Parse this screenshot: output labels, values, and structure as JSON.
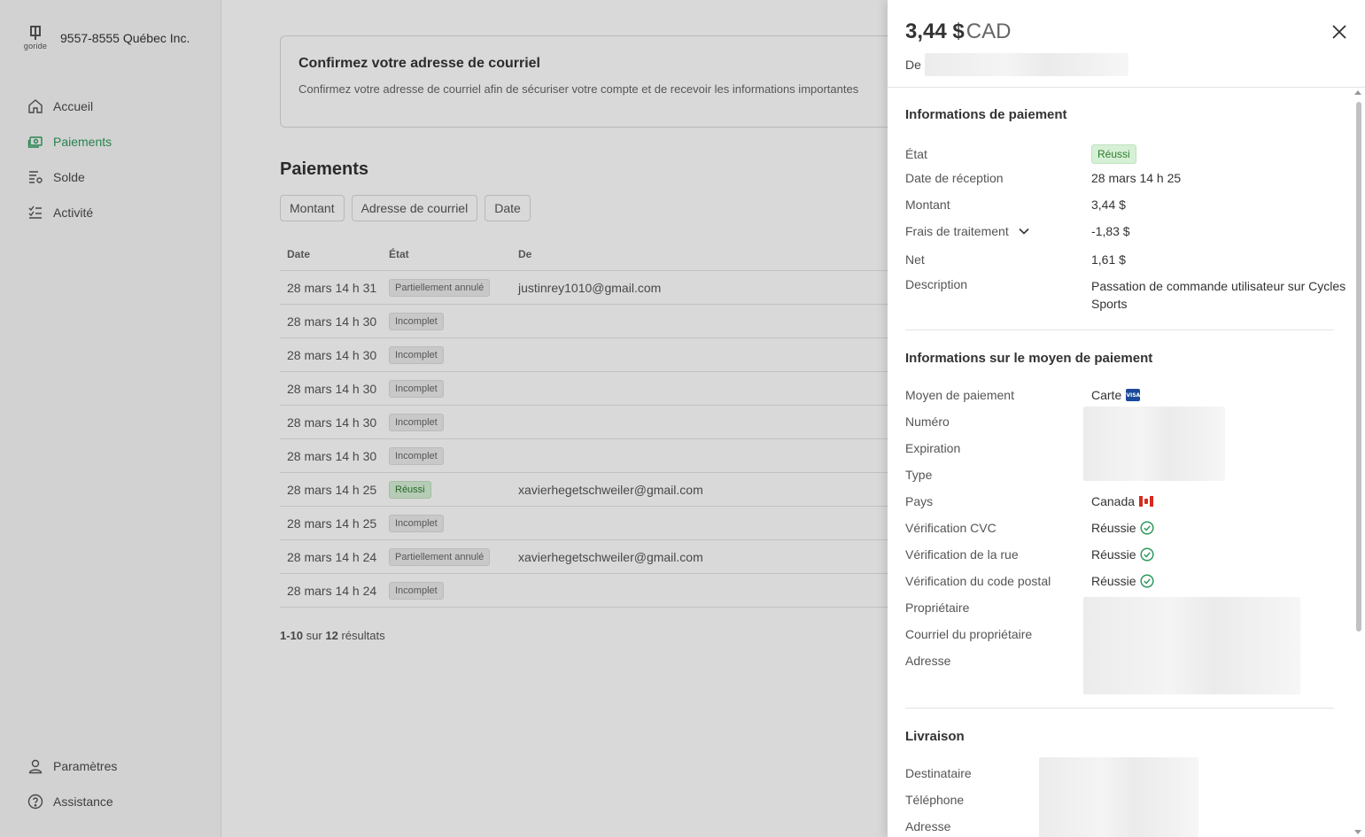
{
  "sidebar": {
    "logo_text": "goride",
    "org_name": "9557-8555 Québec Inc.",
    "items": [
      {
        "label": "Accueil",
        "icon": "home-icon"
      },
      {
        "label": "Paiements",
        "icon": "payments-icon"
      },
      {
        "label": "Solde",
        "icon": "balance-icon"
      },
      {
        "label": "Activité",
        "icon": "activity-icon"
      }
    ],
    "bottom_items": [
      {
        "label": "Paramètres",
        "icon": "user-icon"
      },
      {
        "label": "Assistance",
        "icon": "help-icon"
      }
    ],
    "active_color": "#2e9a5e"
  },
  "banner": {
    "title": "Confirmez votre adresse de courriel",
    "text": "Confirmez votre adresse de courriel afin de sécuriser votre compte et de recevoir les informations importantes"
  },
  "payments": {
    "title": "Paiements",
    "filters": [
      "Montant",
      "Adresse de courriel",
      "Date"
    ],
    "columns": [
      "Date",
      "État",
      "De"
    ],
    "rows": [
      {
        "date": "28 mars 14 h 31",
        "state": "Partiellement annulé",
        "from": "justinrey1010@gmail.com"
      },
      {
        "date": "28 mars 14 h 30",
        "state": "Incomplet",
        "from": ""
      },
      {
        "date": "28 mars 14 h 30",
        "state": "Incomplet",
        "from": ""
      },
      {
        "date": "28 mars 14 h 30",
        "state": "Incomplet",
        "from": ""
      },
      {
        "date": "28 mars 14 h 30",
        "state": "Incomplet",
        "from": ""
      },
      {
        "date": "28 mars 14 h 30",
        "state": "Incomplet",
        "from": ""
      },
      {
        "date": "28 mars 14 h 25",
        "state": "Réussi",
        "from": "xavierhegetschweiler@gmail.com"
      },
      {
        "date": "28 mars 14 h 25",
        "state": "Incomplet",
        "from": ""
      },
      {
        "date": "28 mars 14 h 24",
        "state": "Partiellement annulé",
        "from": "xavierhegetschweiler@gmail.com"
      },
      {
        "date": "28 mars 14 h 24",
        "state": "Incomplet",
        "from": ""
      }
    ],
    "pagination": {
      "range": "1-10",
      "sep": "sur",
      "total": "12",
      "suffix": "résultats"
    }
  },
  "drawer": {
    "amount": "3,44 $",
    "currency": "CAD",
    "from_label": "De",
    "close_icon": "close-icon",
    "payment_info": {
      "title": "Informations de paiement",
      "status_label": "État",
      "status_value": "Réussi",
      "received_label": "Date de réception",
      "received_value": "28 mars 14 h 25",
      "amount_label": "Montant",
      "amount_value": "3,44 $",
      "fees_label": "Frais de traitement",
      "fees_value": "-1,83 $",
      "net_label": "Net",
      "net_value": "1,61 $",
      "description_label": "Description",
      "description_value": "Passation de commande utilisateur sur Cycles Sports"
    },
    "payment_method": {
      "title": "Informations sur le moyen de paiement",
      "method_label": "Moyen de paiement",
      "method_value": "Carte",
      "card_brand": "VISA",
      "number_label": "Numéro",
      "expiration_label": "Expiration",
      "type_label": "Type",
      "country_label": "Pays",
      "country_value": "Canada",
      "cvc_label": "Vérification CVC",
      "cvc_value": "Réussie",
      "street_label": "Vérification de la rue",
      "street_value": "Réussie",
      "postal_label": "Vérification du code postal",
      "postal_value": "Réussie",
      "owner_label": "Propriétaire",
      "owner_email_label": "Courriel du propriétaire",
      "address_label": "Adresse"
    },
    "shipping": {
      "title": "Livraison",
      "recipient_label": "Destinataire",
      "phone_label": "Téléphone",
      "address_label": "Adresse"
    }
  },
  "colors": {
    "success_bg": "#d6f0d6",
    "success_text": "#2f7a2f",
    "check_green": "#2e9a5e"
  }
}
